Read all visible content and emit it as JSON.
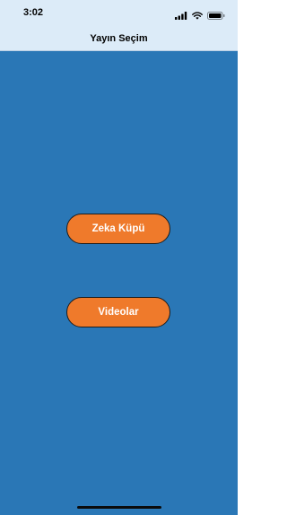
{
  "status_bar": {
    "time": "3:02",
    "icons": [
      "signal-icon",
      "wifi-icon",
      "battery-icon"
    ]
  },
  "nav": {
    "title": "Yayın Seçim"
  },
  "buttons": {
    "zeka_kupu": "Zeka Küpü",
    "videolar": "Videolar"
  },
  "colors": {
    "background": "#2a77b6",
    "top_bar": "#dcebf8",
    "button": "#ef7a2b",
    "button_text": "#ffffff"
  }
}
